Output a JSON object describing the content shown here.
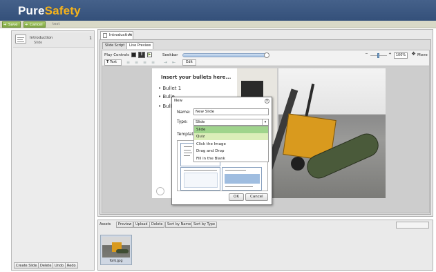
{
  "brand": {
    "part1": "Pure",
    "part2": "Safety"
  },
  "topbar": {
    "save_label": "Save",
    "cancel_label": "Cancel",
    "doc_text": "test"
  },
  "left": {
    "slide": {
      "title": "Introduction",
      "subtitle": "Slide",
      "number": "1"
    },
    "buttons": [
      "Create Slide",
      "Delete",
      "Undo",
      "Redo"
    ]
  },
  "main": {
    "tab_label": "Introduction",
    "subtabs": [
      "Slide Script",
      "Live Preview"
    ],
    "controls": {
      "play_label": "Play Controls",
      "seek_label": "Seekbar",
      "zoom_value": "100%",
      "move_label": "Move"
    },
    "format": {
      "text_btn": "Text",
      "edit_btn": "Edit"
    },
    "slide": {
      "heading": "Insert your bullets here...",
      "bullets": [
        "Bullet 1",
        "Bulle",
        "Bulle"
      ]
    }
  },
  "modal": {
    "title": "New",
    "name_label": "Name:",
    "name_value": "New Slide",
    "type_label": "Type:",
    "type_value": "Slide",
    "options": [
      "Slide",
      "Quiz",
      "Click the Image",
      "Drag and Drop",
      "Fill in the Blank"
    ],
    "template_label": "Template",
    "ok_label": "OK",
    "cancel_label": "Cancel"
  },
  "assets": {
    "label": "Assets",
    "buttons": [
      "Preview",
      "Upload",
      "Delete",
      "Sort by Name",
      "Sort by Type"
    ],
    "file_name": "fork.jpg"
  }
}
